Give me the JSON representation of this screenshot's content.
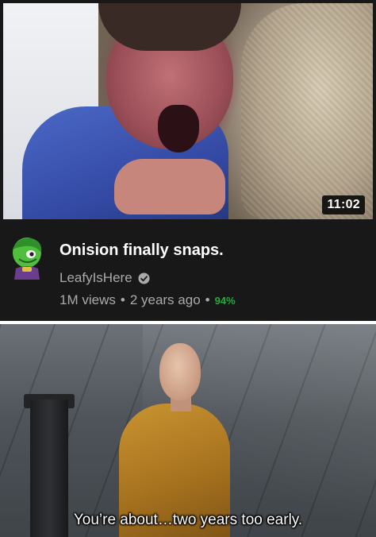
{
  "video": {
    "duration": "11:02",
    "title": "Onision finally snaps.",
    "channel_name": "LeafyIsHere",
    "views": "1M views",
    "separator": "•",
    "age": "2 years ago",
    "like_ratio": "94%"
  },
  "icons": {
    "verified": "checkmark-circle-icon",
    "avatar": "green-character-avatar"
  },
  "colors": {
    "card_background": "#181818",
    "like_ratio": "#2ba640",
    "meta_text": "#aaaaaa"
  },
  "movie_still": {
    "subtitle": "You’re about…two years too early."
  }
}
